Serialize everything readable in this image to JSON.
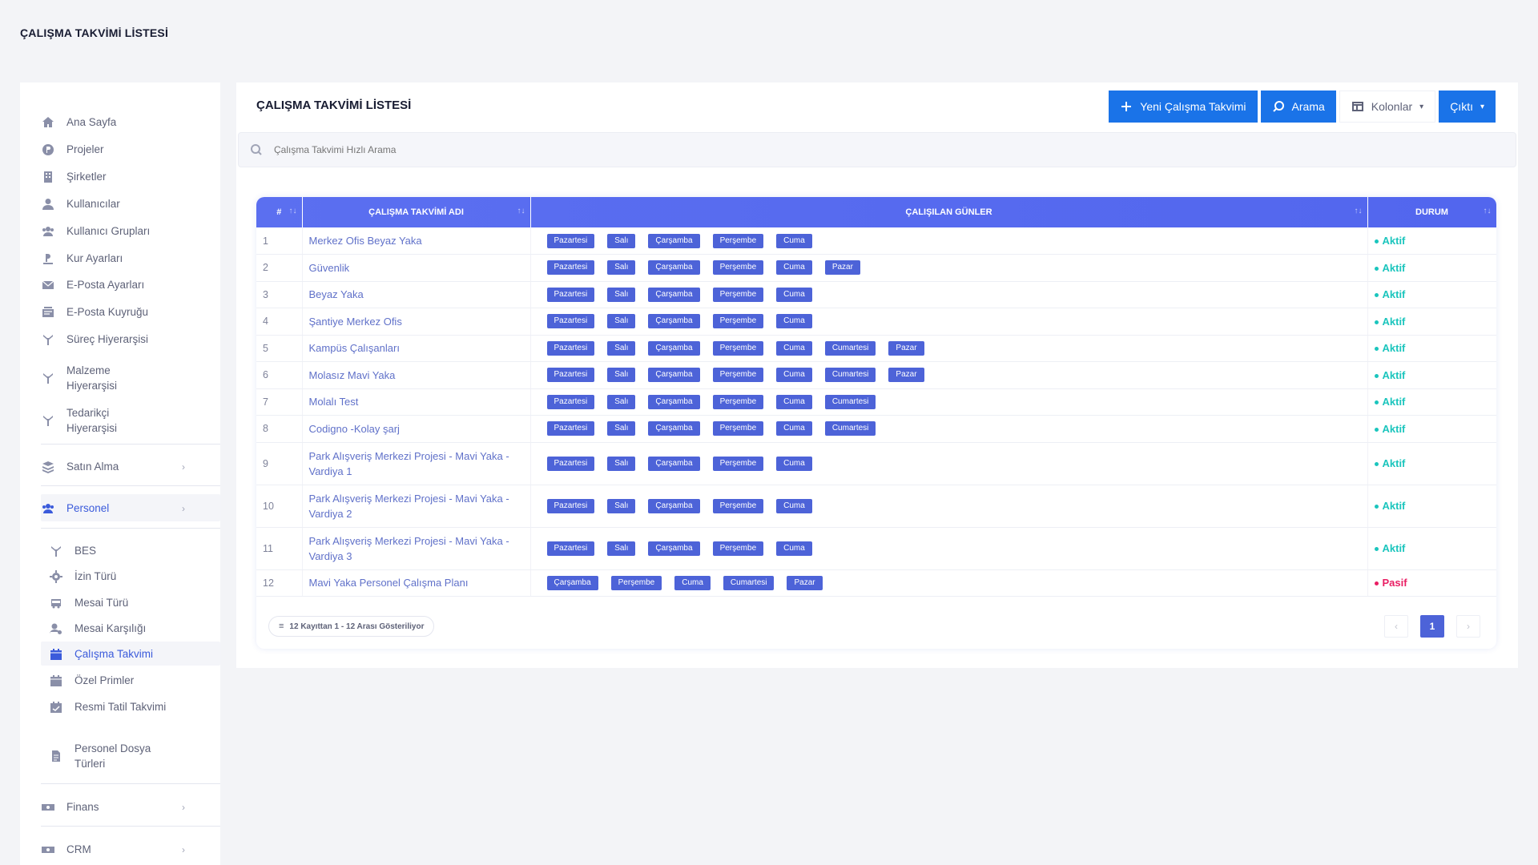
{
  "page": {
    "title": "ÇALIŞMA TAKVİMİ LİSTESİ"
  },
  "sidebar": {
    "items": [
      {
        "label": "Ana Sayfa",
        "icon": "home-icon"
      },
      {
        "label": "Projeler",
        "icon": "projects-icon"
      },
      {
        "label": "Şirketler",
        "icon": "building-icon"
      },
      {
        "label": "Kullanıcılar",
        "icon": "user-icon"
      },
      {
        "label": "Kullanıcı Grupları",
        "icon": "users-icon"
      },
      {
        "label": "Kur Ayarları",
        "icon": "currency-icon"
      },
      {
        "label": "E-Posta Ayarları",
        "icon": "mail-icon"
      },
      {
        "label": "E-Posta Kuyruğu",
        "icon": "mail-queue-icon"
      },
      {
        "label": "Süreç Hiyerarşisi",
        "icon": "hierarchy-icon"
      },
      {
        "label": "Malzeme Hiyerarşisi",
        "icon": "hierarchy-icon"
      },
      {
        "label": "Tedarikçi Hiyerarşisi",
        "icon": "hierarchy-icon"
      }
    ],
    "groups": {
      "satin_alma": "Satın Alma",
      "personel": "Personel",
      "finans": "Finans",
      "crm": "CRM"
    },
    "personel_sub": [
      {
        "label": "BES",
        "icon": "hierarchy-icon"
      },
      {
        "label": "İzin Türü",
        "icon": "gear-icon"
      },
      {
        "label": "Mesai Türü",
        "icon": "bus-icon"
      },
      {
        "label": "Mesai Karşılığı",
        "icon": "user-cog-icon"
      },
      {
        "label": "Çalışma Takvimi",
        "icon": "calendar-icon",
        "active": true
      },
      {
        "label": "Özel Primler",
        "icon": "calendar-icon"
      },
      {
        "label": "Resmi Tatil Takvimi",
        "icon": "calendar-check-icon"
      },
      {
        "label": "Personel Dosya Türleri",
        "icon": "file-icon"
      }
    ]
  },
  "main": {
    "title": "ÇALIŞMA TAKVİMİ LİSTESİ",
    "toolbar": {
      "new_label": "Yeni Çalışma Takvimi",
      "search_label": "Arama",
      "columns_label": "Kolonlar",
      "output_label": "Çıktı"
    },
    "search": {
      "placeholder": "Çalışma Takvimi Hızlı Arama"
    }
  },
  "table": {
    "columns": [
      "#",
      "ÇALIŞMA TAKVİMİ ADI",
      "ÇALIŞILAN GÜNLER",
      "DURUM"
    ],
    "rows": [
      {
        "no": "1",
        "name": "Merkez Ofis Beyaz Yaka",
        "days": [
          "Pazartesi",
          "Salı",
          "Çarşamba",
          "Perşembe",
          "Cuma"
        ],
        "status": "Aktif"
      },
      {
        "no": "2",
        "name": "Güvenlik",
        "days": [
          "Pazartesi",
          "Salı",
          "Çarşamba",
          "Perşembe",
          "Cuma",
          "Pazar"
        ],
        "status": "Aktif"
      },
      {
        "no": "3",
        "name": "Beyaz Yaka",
        "days": [
          "Pazartesi",
          "Salı",
          "Çarşamba",
          "Perşembe",
          "Cuma"
        ],
        "status": "Aktif"
      },
      {
        "no": "4",
        "name": "Şantiye Merkez Ofis",
        "days": [
          "Pazartesi",
          "Salı",
          "Çarşamba",
          "Perşembe",
          "Cuma"
        ],
        "status": "Aktif"
      },
      {
        "no": "5",
        "name": "Kampüs Çalışanları",
        "days": [
          "Pazartesi",
          "Salı",
          "Çarşamba",
          "Perşembe",
          "Cuma",
          "Cumartesi",
          "Pazar"
        ],
        "status": "Aktif"
      },
      {
        "no": "6",
        "name": "Molasız Mavi Yaka",
        "days": [
          "Pazartesi",
          "Salı",
          "Çarşamba",
          "Perşembe",
          "Cuma",
          "Cumartesi",
          "Pazar"
        ],
        "status": "Aktif"
      },
      {
        "no": "7",
        "name": "Molalı Test",
        "days": [
          "Pazartesi",
          "Salı",
          "Çarşamba",
          "Perşembe",
          "Cuma",
          "Cumartesi"
        ],
        "status": "Aktif"
      },
      {
        "no": "8",
        "name": "Codigno -Kolay şarj",
        "days": [
          "Pazartesi",
          "Salı",
          "Çarşamba",
          "Perşembe",
          "Cuma",
          "Cumartesi"
        ],
        "status": "Aktif"
      },
      {
        "no": "9",
        "name": "Park Alışveriş Merkezi Projesi - Mavi Yaka - Vardiya 1",
        "days": [
          "Pazartesi",
          "Salı",
          "Çarşamba",
          "Perşembe",
          "Cuma"
        ],
        "status": "Aktif"
      },
      {
        "no": "10",
        "name": "Park Alışveriş Merkezi Projesi - Mavi Yaka - Vardiya 2",
        "days": [
          "Pazartesi",
          "Salı",
          "Çarşamba",
          "Perşembe",
          "Cuma"
        ],
        "status": "Aktif"
      },
      {
        "no": "11",
        "name": "Park Alışveriş Merkezi Projesi - Mavi Yaka - Vardiya 3",
        "days": [
          "Pazartesi",
          "Salı",
          "Çarşamba",
          "Perşembe",
          "Cuma"
        ],
        "status": "Aktif"
      },
      {
        "no": "12",
        "name": "Mavi Yaka Personel Çalışma Planı",
        "days": [
          "Çarşamba",
          "Perşembe",
          "Cuma",
          "Cumartesi",
          "Pazar"
        ],
        "status": "Pasif"
      }
    ],
    "footer": {
      "count_text": "12 Kayıttan 1 - 12 Arası Gösteriliyor",
      "current_page": "1",
      "prev": "‹",
      "next": "›"
    }
  },
  "colors": {
    "accent": "#1a73e8",
    "header": "#5266ee",
    "badge": "#4d63d8",
    "active": "#1bc5bd",
    "passive": "#e91e63"
  }
}
